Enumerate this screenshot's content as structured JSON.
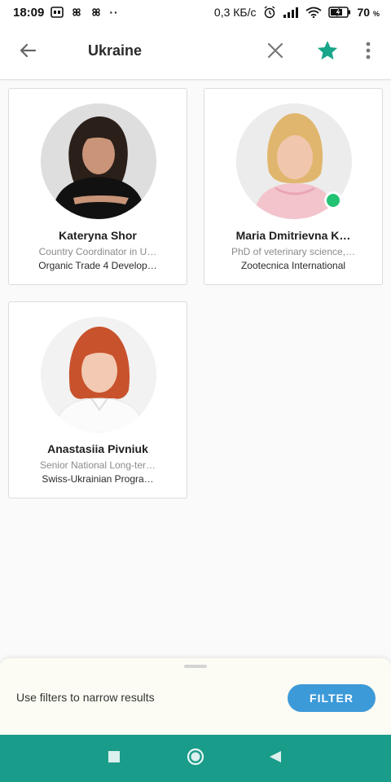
{
  "status_bar": {
    "time": "18:09",
    "overflow_dots": "··",
    "network_speed": "0,3 КБ/с",
    "battery_percent": "70",
    "battery_unit": "%"
  },
  "app_bar": {
    "title": "Ukraine",
    "accent_color": "#19a58a"
  },
  "people": [
    {
      "name": "Kateryna Shor",
      "role": "Country Coordinator in U…",
      "organization": "Organic Trade 4 Develop…",
      "online": false
    },
    {
      "name": "Maria Dmitrievna K…",
      "role": "PhD of veterinary science,…",
      "organization": "Zootecnica International",
      "online": true
    },
    {
      "name": "Anastasiia Pivniuk",
      "role": "Senior National Long-ter…",
      "organization": "Swiss-Ukrainian Progra…",
      "online": false
    }
  ],
  "bottom_sheet": {
    "hint": "Use filters to narrow results",
    "filter_label": "FILTER",
    "button_color": "#3d9ad8"
  },
  "nav_bar": {
    "color": "#1a9c8a",
    "icons": [
      "square-recents-icon",
      "circle-home-icon",
      "triangle-back-icon"
    ]
  }
}
